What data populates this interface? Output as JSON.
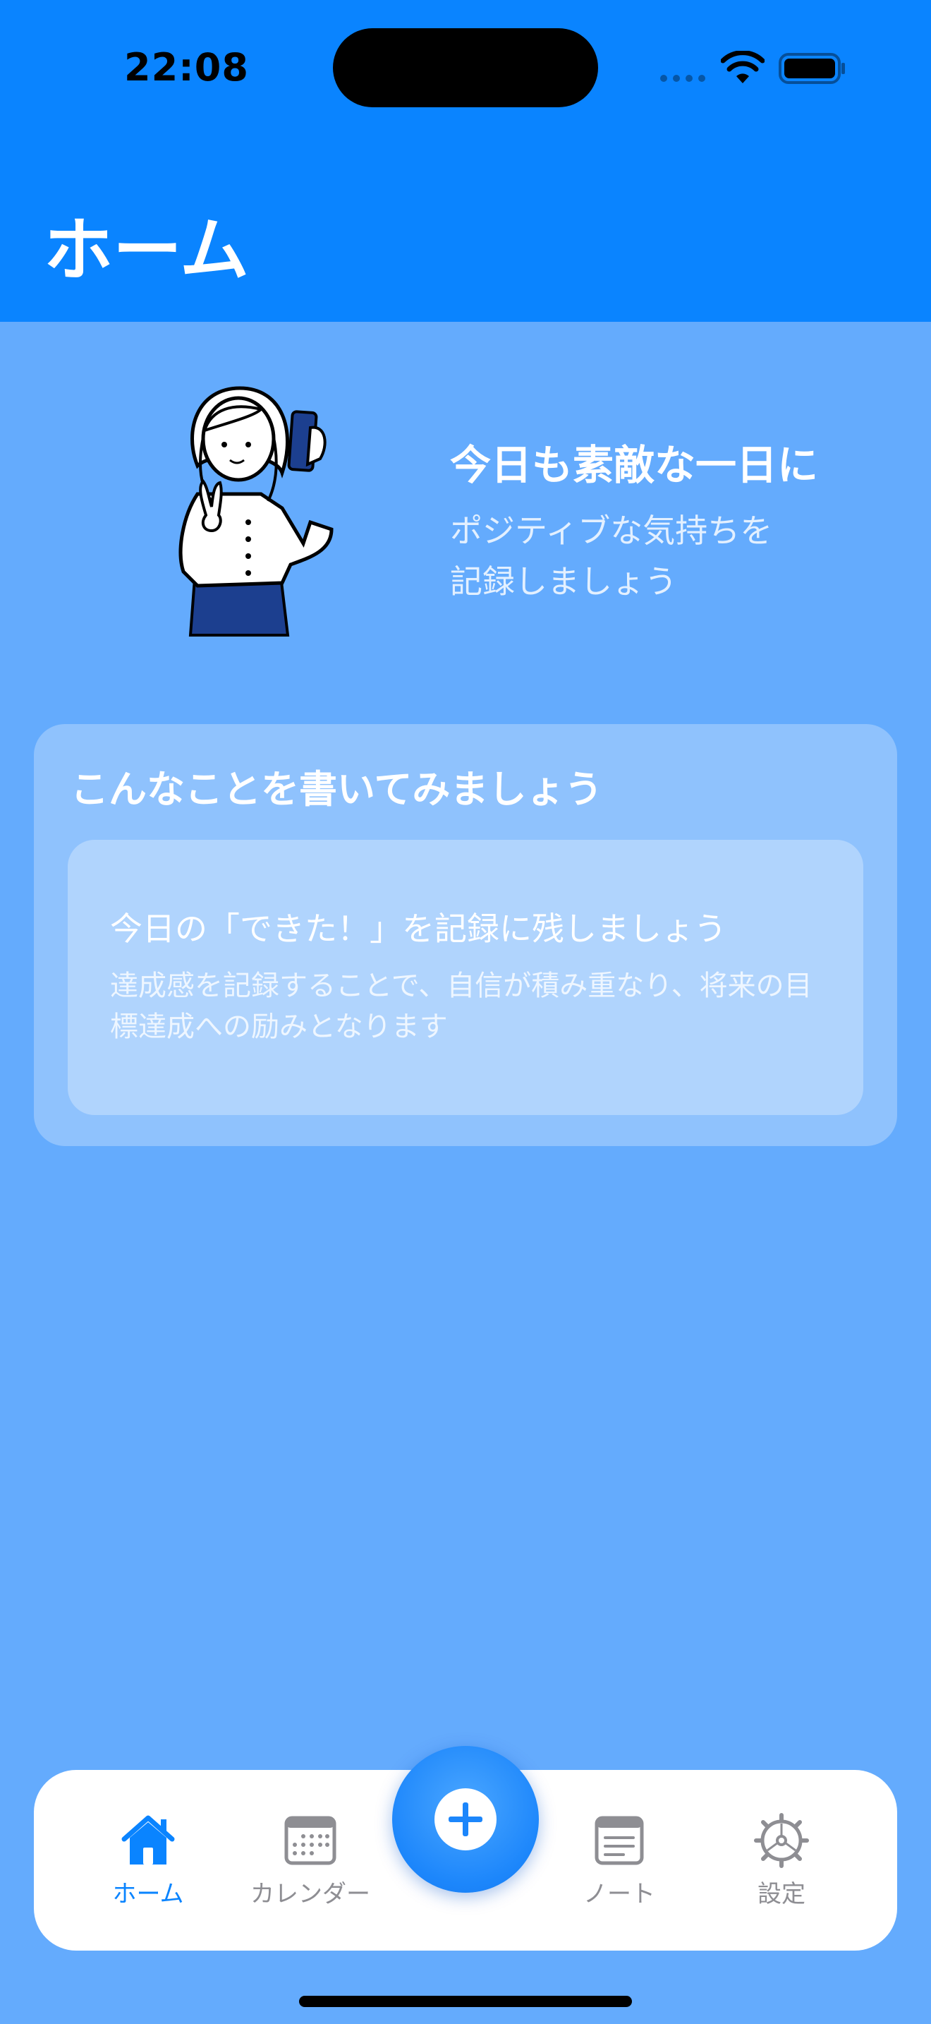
{
  "status_bar": {
    "time": "22:08"
  },
  "header": {
    "title": "ホーム"
  },
  "hero": {
    "illustration_icon": "woman-with-phone-peace-sign-illustration",
    "title": "今日も素敵な一日に",
    "subtitle": "ポジティブな気持ちを\n記録しましょう"
  },
  "suggestions": {
    "title": "こんなことを書いてみましょう",
    "tip": {
      "title": "今日の「できた！」を記録に残しましょう",
      "body": "達成感を記録することで、自信が積み重なり、将来の目標達成への励みとなります"
    }
  },
  "tab_bar": {
    "items": [
      {
        "label": "ホーム",
        "icon": "house-icon",
        "active": true
      },
      {
        "label": "カレンダー",
        "icon": "calendar-icon",
        "active": false
      },
      {
        "label": "ノート",
        "icon": "note-icon",
        "active": false
      },
      {
        "label": "設定",
        "icon": "gear-icon",
        "active": false
      }
    ],
    "add_button_icon": "plus-circle-icon"
  },
  "colors": {
    "header": "#0a84ff",
    "background": "#64abfd",
    "active_tab": "#0a84ff",
    "inactive_tab": "#8e8e93"
  }
}
